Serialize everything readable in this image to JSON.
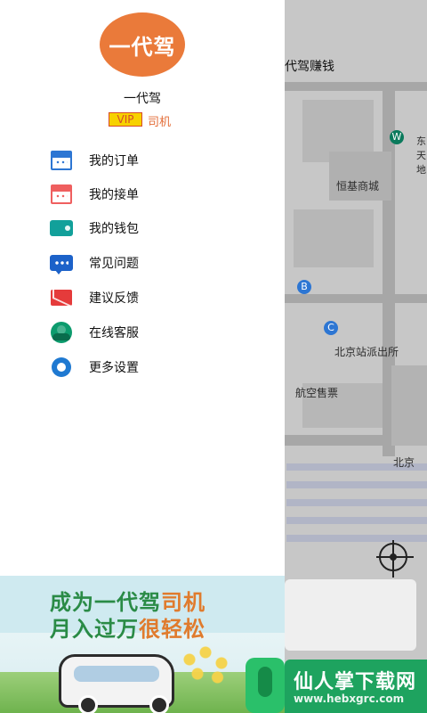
{
  "map": {
    "header_title": "代驾赚钱",
    "labels": {
      "hengji": "恒基商城",
      "police": "北京站派出所",
      "ticket": "航空售票",
      "beijing": "北京",
      "right_vertical_1": "东",
      "right_vertical_2": "天",
      "right_vertical_3": "地"
    },
    "pin_letters": {
      "b": "B",
      "c": "C",
      "w": "W"
    }
  },
  "drawer": {
    "avatar_text": "一代驾",
    "username": "一代驾",
    "vip_badge": "VIP",
    "role_label": "司机",
    "menu": [
      {
        "label": "我的订单",
        "icon": "calendar-icon"
      },
      {
        "label": "我的接单",
        "icon": "calendar-red-icon"
      },
      {
        "label": "我的钱包",
        "icon": "wallet-icon"
      },
      {
        "label": "常见问题",
        "icon": "chat-icon"
      },
      {
        "label": "建议反馈",
        "icon": "mail-icon"
      },
      {
        "label": "在线客服",
        "icon": "customer-service-icon"
      },
      {
        "label": "更多设置",
        "icon": "gear-icon"
      }
    ]
  },
  "promo": {
    "line1_main": "成为一代驾",
    "line1_accent": "司机",
    "line2_main": "月入过万",
    "line2_accent": "很轻松"
  },
  "watermark": {
    "title": "仙人掌下载网",
    "url": "www.hebxgrc.com"
  },
  "colors": {
    "brand_orange": "#ea7a3a",
    "blue_icon": "#2d76d3",
    "green": "#2a8b46"
  }
}
